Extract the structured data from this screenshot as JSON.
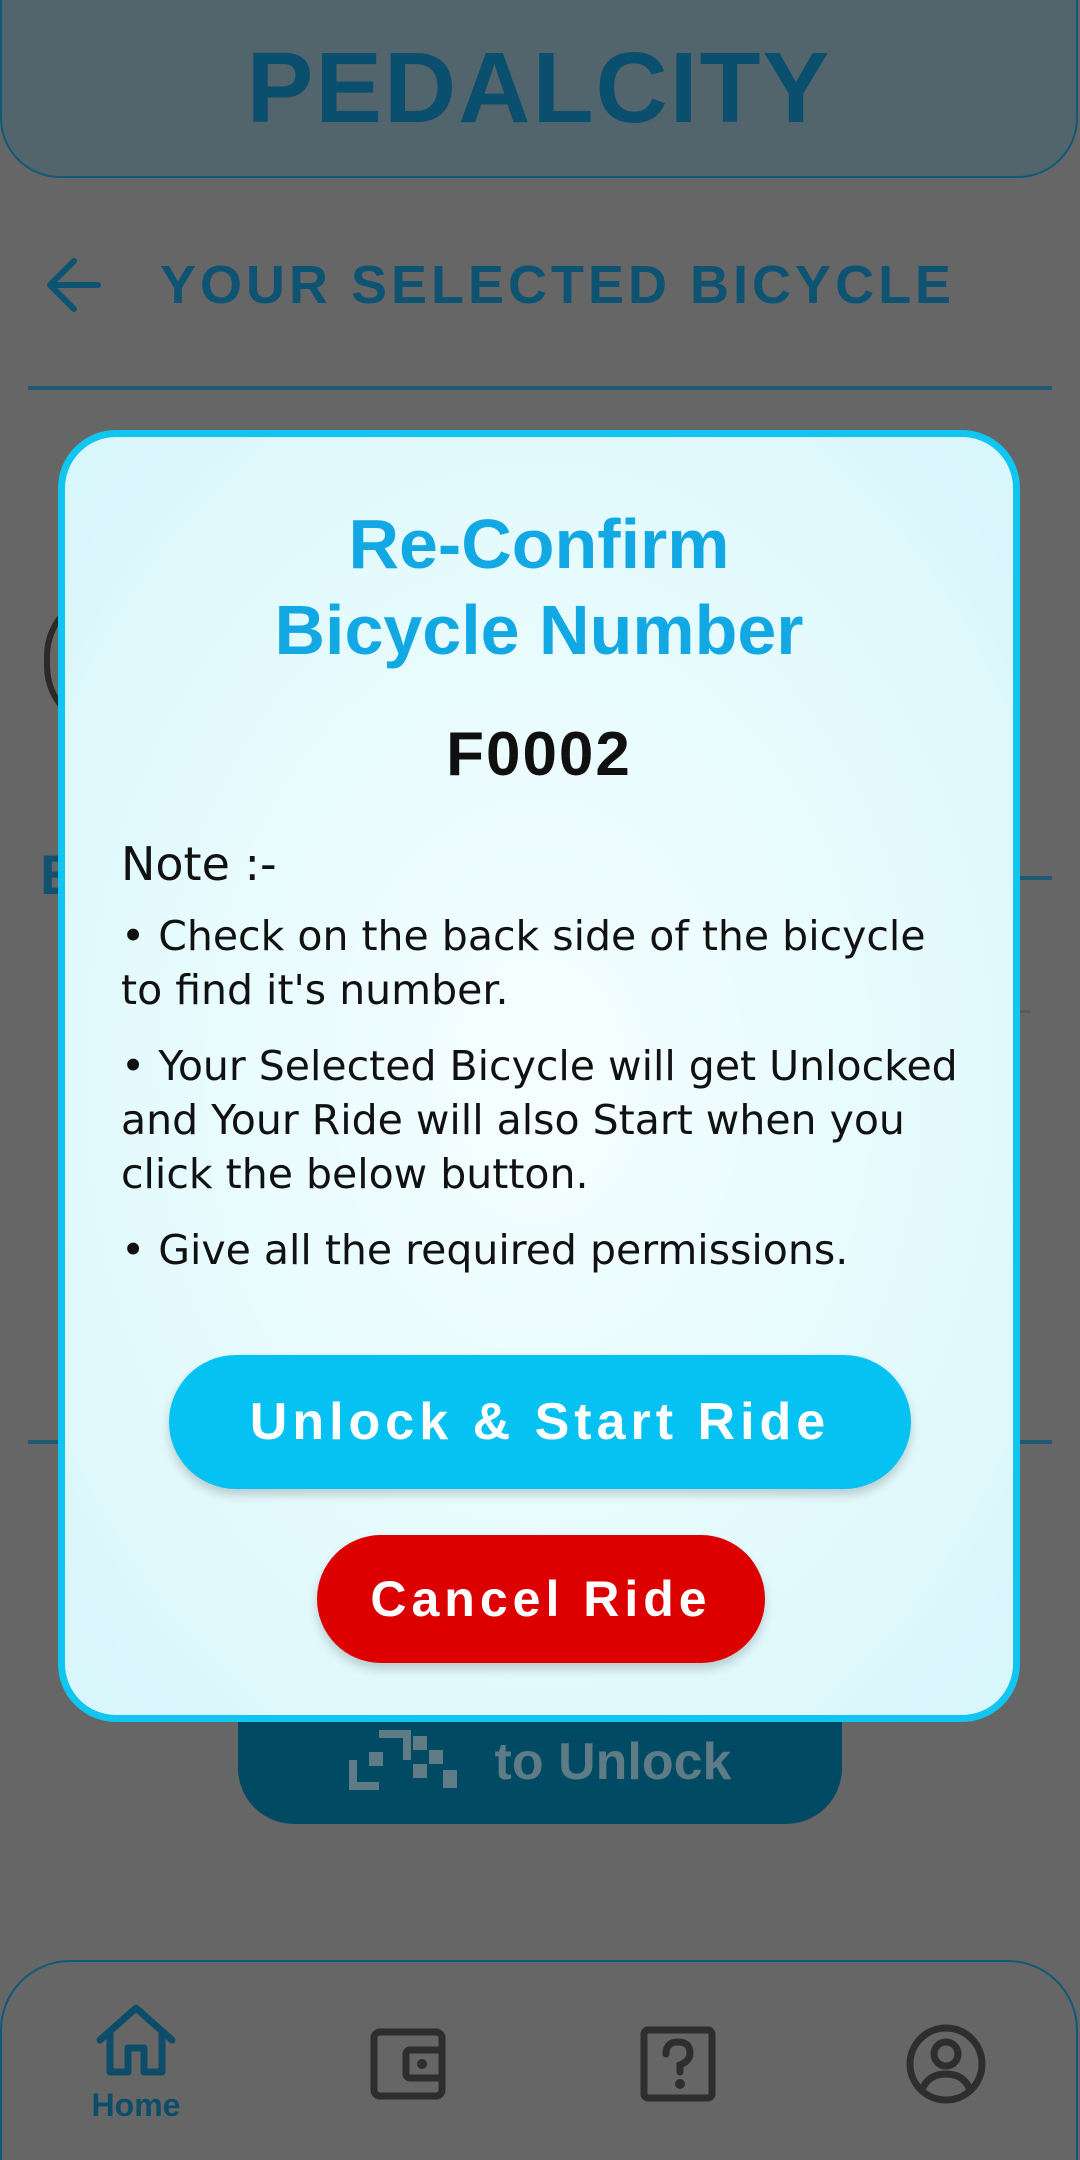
{
  "header": {
    "app_title": "PEDALCITY"
  },
  "subheader": {
    "back_icon": "arrow-left-icon",
    "title": "YOUR SELECTED BICYCLE"
  },
  "background": {
    "section_initial": "E",
    "scan_button_label": "to Unlock",
    "scan_icon": "qr-code-icon"
  },
  "modal": {
    "title_line1": "Re-Confirm",
    "title_line2": "Bicycle Number",
    "bicycle_number": "F0002",
    "note_heading": "Note :-",
    "notes": [
      "• Check on the back side of the bicycle to find it's number.",
      "• Your Selected Bicycle will get Unlocked and Your Ride will also Start when you click the below button.",
      "• Give all the required permissions."
    ],
    "unlock_button": "Unlock & Start Ride",
    "cancel_button": "Cancel Ride"
  },
  "bottom_nav": {
    "items": [
      {
        "label": "Home",
        "icon": "home-icon",
        "active": true
      },
      {
        "label": "",
        "icon": "wallet-icon",
        "active": false
      },
      {
        "label": "",
        "icon": "help-icon",
        "active": false
      },
      {
        "label": "",
        "icon": "profile-icon",
        "active": false
      }
    ]
  },
  "colors": {
    "accent": "#10c6f0",
    "title_blue": "#11a8e4",
    "cancel_red": "#dd0000",
    "overlay": "#666666",
    "brand_dark": "#0b4f6e"
  }
}
